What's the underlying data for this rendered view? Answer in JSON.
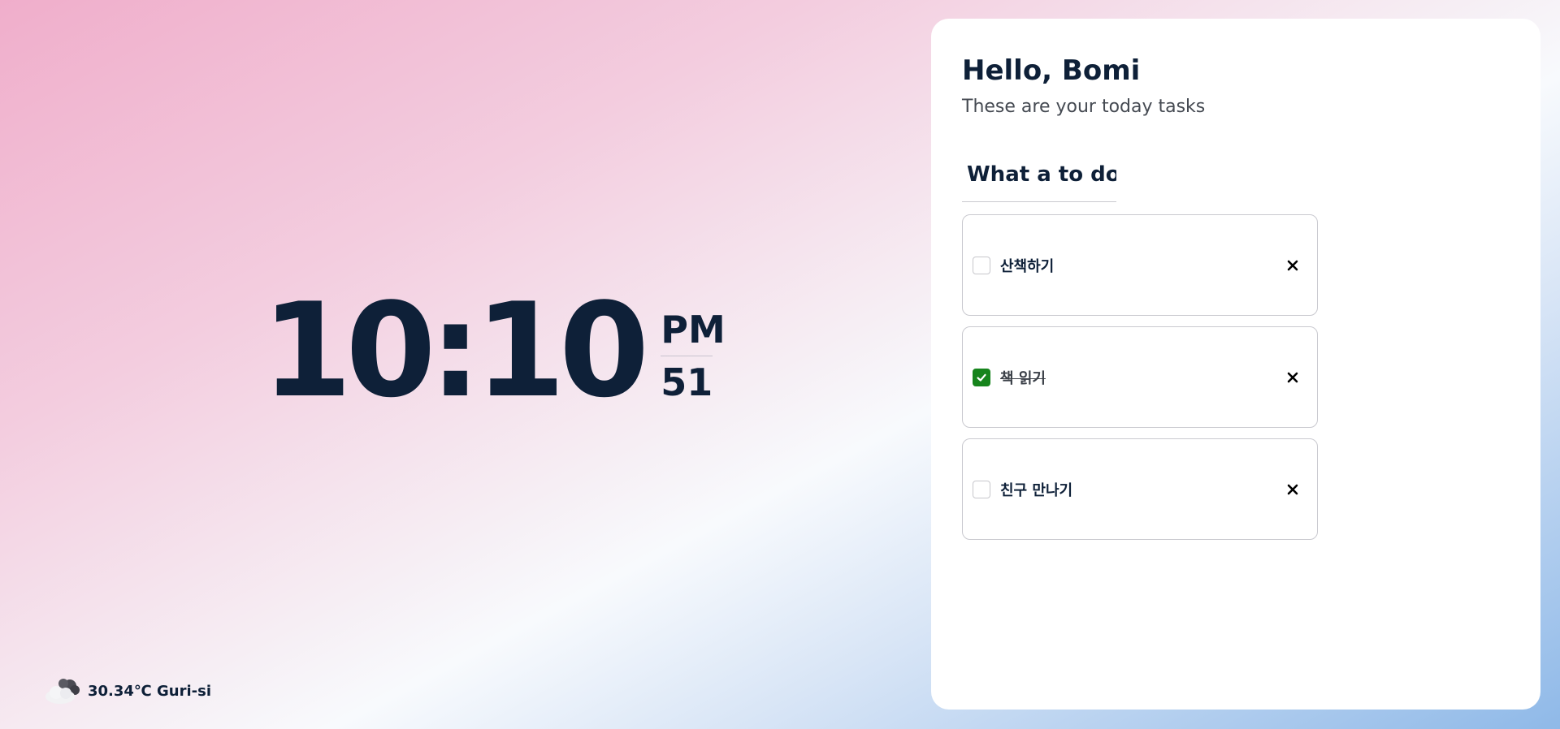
{
  "clock": {
    "time": "10:10",
    "ampm": "PM",
    "seconds": "51"
  },
  "weather": {
    "icon": "cloud-icon",
    "text": "30.34℃ Guri-si"
  },
  "panel": {
    "greeting": "Hello, Bomi",
    "subtitle": "These are your today tasks",
    "todo_input_value": "What a to do"
  },
  "todos": [
    {
      "label": "산책하기",
      "checked": false
    },
    {
      "label": "책 읽기",
      "checked": true
    },
    {
      "label": "친구 만나기",
      "checked": false
    }
  ],
  "colors": {
    "text": "#0e2038",
    "checkbox_checked": "#16841c"
  }
}
